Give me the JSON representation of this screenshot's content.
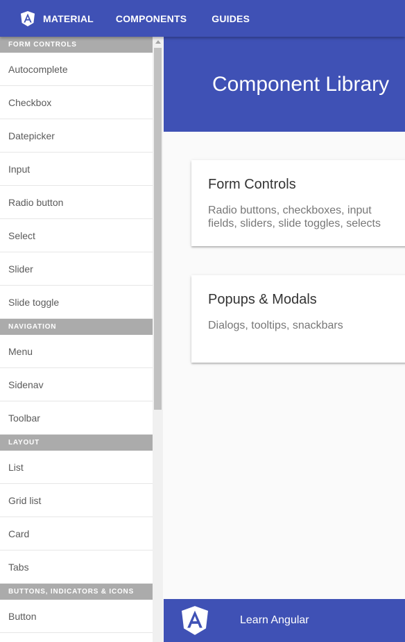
{
  "topbar": {
    "brand_label": "MATERIAL",
    "components_label": "COMPONENTS",
    "guides_label": "GUIDES",
    "brand_icon": "angular-logo-icon"
  },
  "sidenav": {
    "sections": [
      {
        "title": "FORM CONTROLS",
        "items": [
          "Autocomplete",
          "Checkbox",
          "Datepicker",
          "Input",
          "Radio button",
          "Select",
          "Slider",
          "Slide toggle"
        ]
      },
      {
        "title": "NAVIGATION",
        "items": [
          "Menu",
          "Sidenav",
          "Toolbar"
        ]
      },
      {
        "title": "LAYOUT",
        "items": [
          "List",
          "Grid list",
          "Card",
          "Tabs"
        ]
      },
      {
        "title": "BUTTONS, INDICATORS & ICONS",
        "items": [
          "Button"
        ]
      }
    ]
  },
  "main": {
    "hero_title": "Component Library",
    "cards": [
      {
        "title": "Form Controls",
        "description": "Radio buttons, checkboxes, input fields, sliders, slide toggles, selects"
      },
      {
        "title": "Popups & Modals",
        "description": "Dialogs, tooltips, snackbars"
      }
    ],
    "footer": {
      "learn_label": "Learn Angular"
    }
  },
  "colors": {
    "primary": "#3f51b5",
    "section_header": "#ababab",
    "background": "#fafafa"
  }
}
